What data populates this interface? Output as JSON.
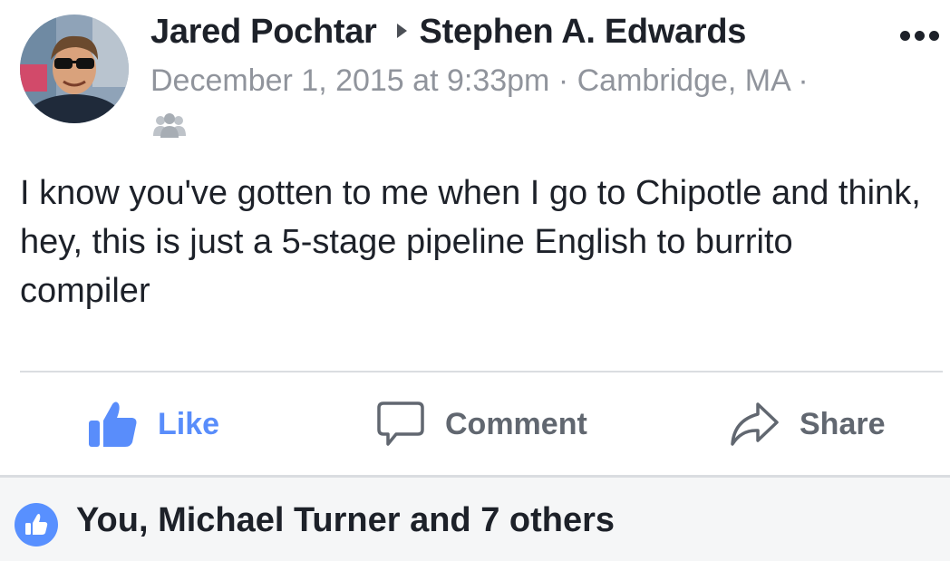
{
  "post": {
    "author": "Jared Pochtar",
    "recipient": "Stephen A. Edwards",
    "timestamp": "December 1, 2015 at 9:33pm",
    "location": "Cambridge, MA",
    "separator": "·",
    "audience_icon": "friends-icon",
    "text": "I know you've gotten to me when I go to Chipotle and think, hey, this is just a 5-stage pipeline English to burrito compiler"
  },
  "actions": {
    "like_label": "Like",
    "comment_label": "Comment",
    "share_label": "Share"
  },
  "reactions": {
    "summary": "You, Michael Turner and 7 others",
    "icon": "thumbs-up-icon"
  },
  "colors": {
    "like_blue": "#598dfb",
    "badge_blue": "#5890ff",
    "text_dark": "#1d2129",
    "text_muted": "#90949c",
    "action_gray": "#616770"
  }
}
